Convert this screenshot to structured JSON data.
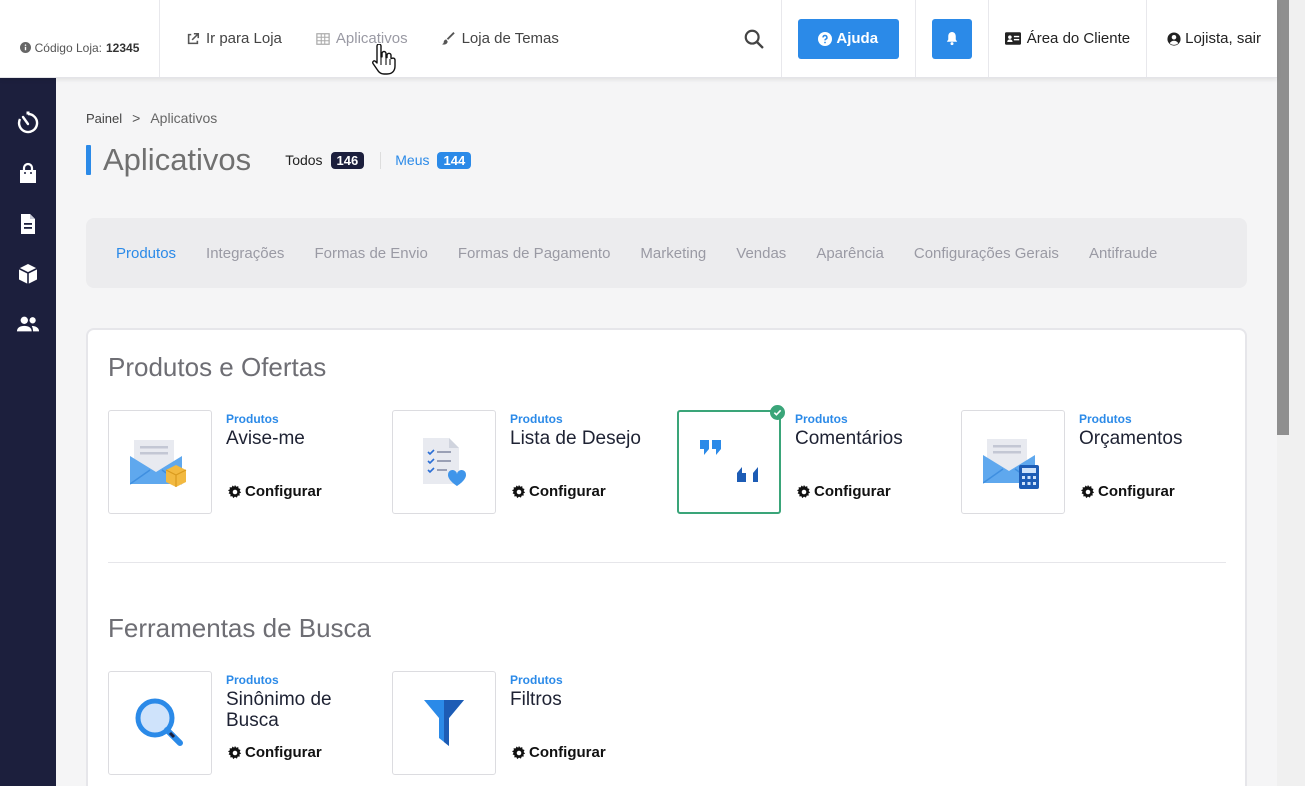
{
  "header": {
    "store_code_label": "Código Loja:",
    "store_code_value": "12345",
    "nav": [
      {
        "label": "Ir para Loja",
        "icon": "external-link-icon"
      },
      {
        "label": "Aplicativos",
        "icon": "grid-icon"
      },
      {
        "label": "Loja de Temas",
        "icon": "brush-icon"
      }
    ],
    "help_label": "Ajuda",
    "client_area_label": "Área do Cliente",
    "logout_label": "Lojista, sair"
  },
  "sidebar": {
    "items": [
      {
        "icon": "dashboard-timer-icon"
      },
      {
        "icon": "shopping-bag-icon"
      },
      {
        "icon": "document-icon"
      },
      {
        "icon": "box-icon"
      },
      {
        "icon": "users-icon"
      }
    ]
  },
  "breadcrumb": {
    "root": "Painel",
    "separator": ">",
    "current": "Aplicativos"
  },
  "page": {
    "title": "Aplicativos",
    "filter_all_label": "Todos",
    "filter_all_count": "146",
    "filter_mine_label": "Meus",
    "filter_mine_count": "144"
  },
  "tabs": [
    "Produtos",
    "Integrações",
    "Formas de Envio",
    "Formas de Pagamento",
    "Marketing",
    "Vendas",
    "Aparência",
    "Configurações Gerais",
    "Antifraude"
  ],
  "active_tab": "Produtos",
  "sections": [
    {
      "title": "Produtos e Ofertas",
      "apps": [
        {
          "category": "Produtos",
          "name": "Avise-me",
          "action": "Configurar",
          "icon": "envelope-box-icon",
          "installed": false
        },
        {
          "category": "Produtos",
          "name": "Lista de Desejo",
          "action": "Configurar",
          "icon": "wishlist-doc-icon",
          "installed": false
        },
        {
          "category": "Produtos",
          "name": "Comentários",
          "action": "Configurar",
          "icon": "quotes-icon",
          "installed": true
        },
        {
          "category": "Produtos",
          "name": "Orçamentos",
          "action": "Configurar",
          "icon": "envelope-calculator-icon",
          "installed": false
        }
      ]
    },
    {
      "title": "Ferramentas de Busca",
      "apps": [
        {
          "category": "Produtos",
          "name": "Sinônimo de Busca",
          "action": "Configurar",
          "icon": "magnifier-icon",
          "installed": false
        },
        {
          "category": "Produtos",
          "name": "Filtros",
          "action": "Configurar",
          "icon": "funnel-icon",
          "installed": false
        }
      ]
    }
  ],
  "colors": {
    "accent": "#2b8ae8",
    "sidebar": "#1c1f3d",
    "installed": "#3aa579"
  }
}
